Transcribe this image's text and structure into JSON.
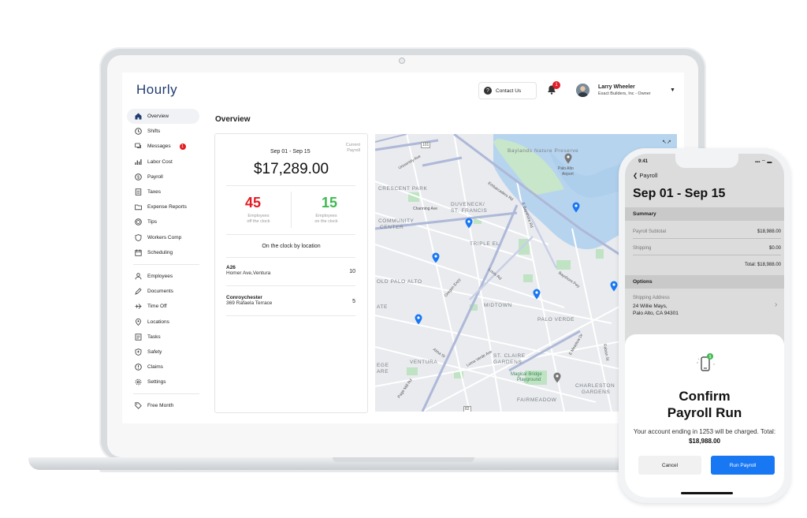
{
  "app": {
    "logo": "Hourly"
  },
  "header": {
    "contact_label": "Contact Us",
    "notification_count": "1",
    "user_name": "Larry Wheeler",
    "user_role": "Exact Builders, Inc - Owner"
  },
  "sidebar": {
    "items": [
      {
        "label": "Overview",
        "icon": "home-icon"
      },
      {
        "label": "Shifts",
        "icon": "clock-icon"
      },
      {
        "label": "Messages",
        "icon": "chat-icon",
        "badge": "1"
      },
      {
        "label": "Labor Cost",
        "icon": "bar-chart-icon"
      },
      {
        "label": "Payroll",
        "icon": "dollar-circle-icon"
      },
      {
        "label": "Taxes",
        "icon": "document-icon"
      },
      {
        "label": "Expense Reports",
        "icon": "folder-icon"
      },
      {
        "label": "Tips",
        "icon": "coin-icon"
      },
      {
        "label": "Workers Comp",
        "icon": "shield-icon"
      },
      {
        "label": "Scheduling",
        "icon": "calendar-icon"
      }
    ],
    "items2": [
      {
        "label": "Employees",
        "icon": "person-icon"
      },
      {
        "label": "Documents",
        "icon": "pen-icon"
      },
      {
        "label": "Time Off",
        "icon": "plane-icon"
      },
      {
        "label": "Locations",
        "icon": "pin-icon"
      },
      {
        "label": "Tasks",
        "icon": "task-icon"
      },
      {
        "label": "Safety",
        "icon": "safety-icon"
      },
      {
        "label": "Claims",
        "icon": "alert-icon"
      },
      {
        "label": "Settings",
        "icon": "gear-icon"
      }
    ],
    "items3": [
      {
        "label": "Free Month",
        "icon": "tag-icon"
      }
    ]
  },
  "main": {
    "title": "Overview",
    "card": {
      "period": "Sep 01 - Sep 15",
      "period_tag_line1": "Current",
      "period_tag_line2": "Payroll",
      "amount": "$17,289.00",
      "off_clock_count": "45",
      "off_clock_line1": "Employees",
      "off_clock_line2": "off the clock",
      "on_clock_count": "15",
      "on_clock_line1": "Employees",
      "on_clock_line2": "on the clock",
      "by_location_title": "On the clock by location",
      "locations": [
        {
          "name": "A26",
          "address": "Homer Ave,Ventura",
          "count": "10"
        },
        {
          "name": "Conroychester",
          "address": "369 Rafaela Terrace",
          "count": "5"
        }
      ]
    },
    "map": {
      "labels": {
        "baylands": "Baylands Nature Preserve",
        "palo_alto_airport_1": "Palo Alto",
        "palo_alto_airport_2": "Airport",
        "crescent_park": "CRESCENT PARK",
        "duveneck_1": "DUVENECK/",
        "duveneck_2": "ST. FRANCIS",
        "community_1": "COMMUNITY",
        "community_2": "CENTER",
        "triple_el": "TRIPLE EL",
        "old_palo_alto": "OLD PALO ALTO",
        "midtown": "MIDTOWN",
        "palo_verde": "PALO VERDE",
        "ventura": "VENTURA",
        "st_claire_1": "ST. CLAIRE",
        "st_claire_2": "GARDENS",
        "magical_1": "Magical Bridge",
        "magical_2": "Playground",
        "charleston_1": "CHARLESTON",
        "charleston_2": "GARDENS",
        "fairmeadow": "FAIRMEADOW",
        "university_ave": "University Ave",
        "embarcadero_rd": "Embarcadero Rd",
        "channing_ave": "Channing Ave",
        "e_bayshore_rd": "E Bayshore Rd",
        "louis_rd": "Louis Rd",
        "oregon_expy": "Oregon Expy",
        "bayshore_fwy": "Bayshore Fwy",
        "alma_st": "Alma St",
        "loma_verde_ave": "Loma Verde Ave",
        "e_meadow_dr": "E Meadow Dr",
        "fabian_st": "Fabian St",
        "page_mill_rd": "Page Mill Rd",
        "ate": "ATE",
        "ege": "EGE",
        "are": "ARE",
        "route_101": "101",
        "route_82": "82",
        "expand": "↖↗"
      }
    }
  },
  "phone": {
    "time": "9:41",
    "status_icons": "▪▪▪ ⌔ ▬",
    "back_label": "Payroll",
    "title": "Sep 01 - Sep 15",
    "summary_header": "Summary",
    "payroll_subtotal_label": "Payroll Subtotal",
    "payroll_subtotal_value": "$18,988.00",
    "shipping_label": "Shipping",
    "shipping_value": "$0.00",
    "total_text": "Total: $18,988.00",
    "options_header": "Options",
    "shipping_address_label": "Shipping Address",
    "shipping_address_line1": "24 Willie Mays,",
    "shipping_address_line2": "Palo Alto, CA 94301",
    "confirm_line1": "Confirm",
    "confirm_line2": "Payroll Run",
    "charge_text": "Your account ending in 1253 will be charged. Total:",
    "charge_total": "$18,988.00",
    "cancel_label": "Cancel",
    "run_label": "Run Payroll"
  },
  "colors": {
    "brand_blue": "#1877f2",
    "logo_navy": "#1f3c70",
    "alert_red": "#e31b23",
    "ok_green": "#3fb950"
  }
}
